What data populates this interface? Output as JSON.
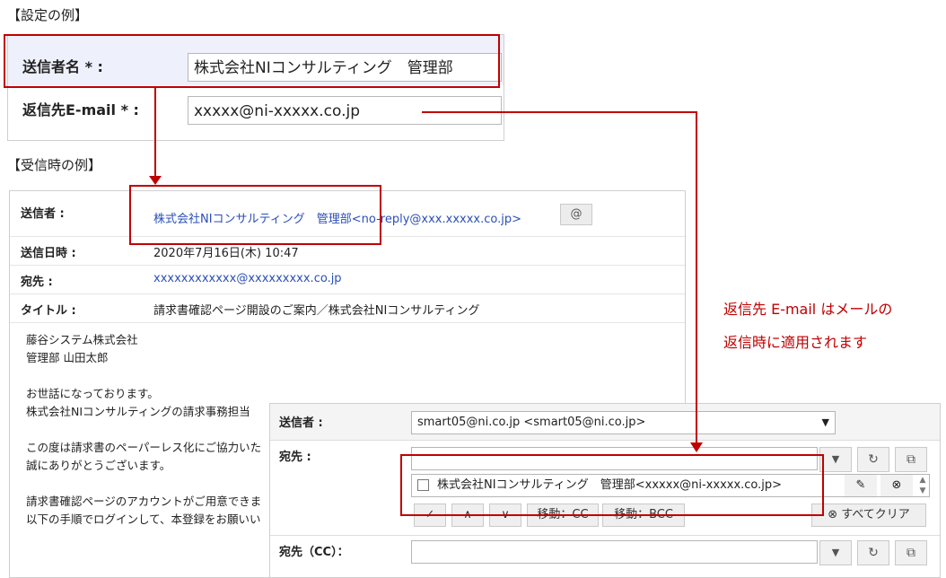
{
  "headings": {
    "settings_example": "【設定の例】",
    "received_example": "【受信時の例】"
  },
  "settings": {
    "sender_name_label": "送信者名 * :",
    "sender_name_value": "株式会社NIコンサルティング　管理部",
    "reply_email_label": "返信先E-mail * :",
    "reply_email_value": "xxxxx@ni-xxxxx.co.jp"
  },
  "mail": {
    "from_label": "送信者 :",
    "from_value": "株式会社NIコンサルティング　管理部<no-reply@xxx.xxxxx.co.jp>",
    "date_label": "送信日時 :",
    "date_value": "2020年7月16日(木) 10:47",
    "to_label": "宛先 :",
    "to_value": "xxxxxxxxxxxx@xxxxxxxxx.co.jp",
    "subject_label": "タイトル :",
    "subject_value": "請求書確認ページ開設のご案内／株式会社NIコンサルティング",
    "body_lines": [
      "藤谷システム株式会社",
      "管理部 山田太郎",
      "",
      "お世話になっております。",
      "株式会社NIコンサルティングの請求事務担当",
      "",
      "この度は請求書のペーパーレス化にご協力いた",
      "誠にありがとうございます。",
      "",
      "請求書確認ページのアカウントがご用意できま",
      "以下の手順でログインして、本登録をお願いい"
    ]
  },
  "annotation": {
    "line1": "返信先  E-mail  はメールの",
    "line2": "返信時に適用されます"
  },
  "compose": {
    "from_label": "送信者 :",
    "from_value": "smart05@ni.co.jp <smart05@ni.co.jp>",
    "to_label": "宛先 :",
    "recipient": "株式会社NIコンサルティング　管理部<xxxxx@ni-xxxxx.co.jp>",
    "check_label": "✓",
    "up_label": "∧",
    "down_label": "∨",
    "move_cc_label": "移動：CC",
    "move_bcc_label": "移動：BCC",
    "clear_all_label": "すべてクリア",
    "cc_label": "宛先（CC）："
  }
}
